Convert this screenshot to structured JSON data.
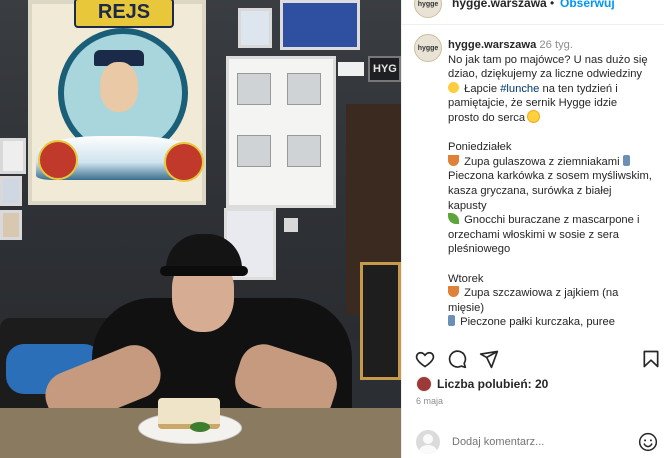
{
  "header": {
    "avatar_text": "hygge",
    "username": "hygge.warszawa",
    "dot": "•",
    "follow_label": "Obserwuj"
  },
  "post": {
    "avatar_text": "hygge",
    "username": "hygge.warszawa",
    "time": "26 tyg.",
    "lines": [
      {
        "segments": [
          {
            "text": "No jak tam po majówce? U nas dużo się"
          }
        ]
      },
      {
        "segments": [
          {
            "text": "dziao, dziękujemy za liczne odwiedziny"
          }
        ]
      },
      {
        "segments": [
          {
            "emoji": "smile"
          },
          {
            "text": " Łapcie "
          },
          {
            "tag": "#lunche"
          },
          {
            "text": " na ten tydzień i"
          }
        ]
      },
      {
        "segments": [
          {
            "text": "pamiętajcie, że sernik Hygge idzie"
          }
        ]
      },
      {
        "segments": [
          {
            "text": "prosto do serca "
          },
          {
            "emoji": "sun"
          }
        ]
      },
      {
        "gap": true
      },
      {
        "segments": [
          {
            "text": "Poniedziałek"
          }
        ]
      },
      {
        "segments": [
          {
            "emoji": "bowl"
          },
          {
            "text": " Zupa gulaszowa z ziemniakami "
          },
          {
            "emoji": "glass"
          }
        ]
      },
      {
        "segments": [
          {
            "text": "Pieczona karkówka z sosem myśliwskim,"
          }
        ]
      },
      {
        "segments": [
          {
            "text": "kasza gryczana, surówka z białej"
          }
        ]
      },
      {
        "segments": [
          {
            "text": "kapusty"
          }
        ]
      },
      {
        "segments": [
          {
            "emoji": "leaf"
          },
          {
            "text": " Gnocchi buraczane z mascarpone i"
          }
        ]
      },
      {
        "segments": [
          {
            "text": "orzechami włoskimi w sosie z sera"
          }
        ]
      },
      {
        "segments": [
          {
            "text": "pleśniowego"
          }
        ]
      },
      {
        "gap": true
      },
      {
        "segments": [
          {
            "text": "Wtorek"
          }
        ]
      },
      {
        "segments": [
          {
            "emoji": "bowl"
          },
          {
            "text": " Zupa szczawiowa z jajkiem (na"
          }
        ]
      },
      {
        "segments": [
          {
            "text": "mięsie)"
          }
        ]
      },
      {
        "segments": [
          {
            "emoji": "glass"
          },
          {
            "text": " Pieczone pałki kurczaka, puree"
          }
        ]
      }
    ]
  },
  "actions": {
    "like_icon": "heart-icon",
    "comment_icon": "comment-icon",
    "share_icon": "share-icon",
    "save_icon": "bookmark-icon"
  },
  "likes": {
    "label": "Liczba polubień: 20"
  },
  "date": "6 maja",
  "comment": {
    "placeholder": "Dodaj komentarz..."
  },
  "colors": {
    "accent": "#0095f6",
    "text": "#262626",
    "muted": "#8e8e8e",
    "hashtag": "#00376b"
  }
}
